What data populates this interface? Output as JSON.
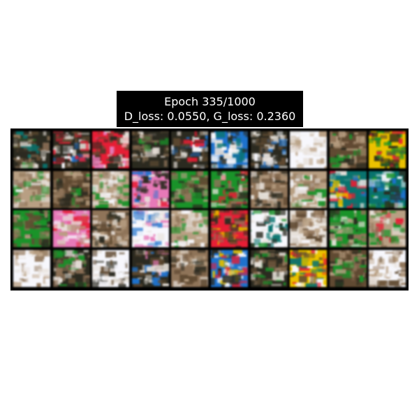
{
  "title": {
    "line1": "Epoch 335/1000",
    "line2": "D_loss: 0.0550, G_loss: 0.2360"
  },
  "grid": {
    "rows": 4,
    "cols": 10,
    "palette": [
      "#2b2a22",
      "#5c4b38",
      "#8a7560",
      "#b3a08a",
      "#e6e1dc",
      "#f7f7fb",
      "#2e8b3a",
      "#c2283a",
      "#2f6fb5",
      "#e0c020",
      "#1c6e6a",
      "#d47fb0"
    ],
    "tiles": [
      {
        "tone": "dark-textured"
      },
      {
        "tone": "dark-mixed"
      },
      {
        "tone": "red-pink"
      },
      {
        "tone": "dark-green"
      },
      {
        "tone": "dark-mixed"
      },
      {
        "tone": "blue-teal"
      },
      {
        "tone": "dark-white"
      },
      {
        "tone": "white-pale"
      },
      {
        "tone": "brown-dark"
      },
      {
        "tone": "yellow-green"
      },
      {
        "tone": "beige-light"
      },
      {
        "tone": "brown-dark"
      },
      {
        "tone": "beige-light"
      },
      {
        "tone": "magenta-blue"
      },
      {
        "tone": "green-brown"
      },
      {
        "tone": "green-red"
      },
      {
        "tone": "brown-mixed"
      },
      {
        "tone": "beige-green"
      },
      {
        "tone": "teal-mixed"
      },
      {
        "tone": "teal-dark"
      },
      {
        "tone": "green-brown"
      },
      {
        "tone": "pink-white"
      },
      {
        "tone": "brown-mixed"
      },
      {
        "tone": "white-lavender"
      },
      {
        "tone": "beige-green"
      },
      {
        "tone": "red-brown"
      },
      {
        "tone": "white-teal"
      },
      {
        "tone": "white-brown"
      },
      {
        "tone": "green-grey"
      },
      {
        "tone": "beige-mixed"
      },
      {
        "tone": "white-light"
      },
      {
        "tone": "dark-green"
      },
      {
        "tone": "white-black"
      },
      {
        "tone": "dark-purple"
      },
      {
        "tone": "brown-mixed"
      },
      {
        "tone": "blue-white"
      },
      {
        "tone": "dark-green"
      },
      {
        "tone": "yellow-teal"
      },
      {
        "tone": "brown-dark"
      },
      {
        "tone": "white-beige"
      }
    ]
  }
}
